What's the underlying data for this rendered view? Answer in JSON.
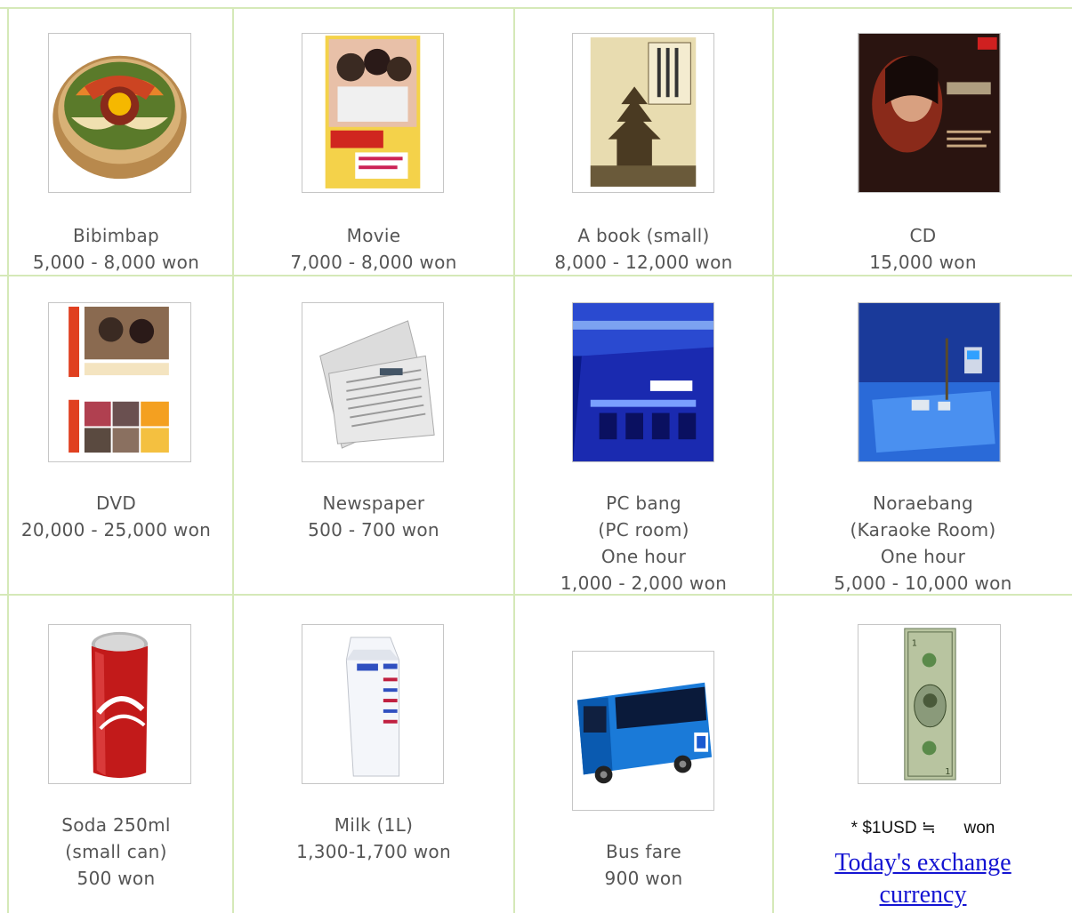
{
  "items": [
    {
      "name": "Bibimbap",
      "lines": [
        "Bibimbap",
        "5,000 - 8,000 won"
      ]
    },
    {
      "name": "Movie",
      "lines": [
        "Movie",
        "7,000 - 8,000 won"
      ]
    },
    {
      "name": "A book (small)",
      "lines": [
        "A book (small)",
        "8,000 - 12,000 won"
      ]
    },
    {
      "name": "CD",
      "lines": [
        "CD",
        "15,000 won"
      ]
    },
    {
      "name": "DVD",
      "lines": [
        "DVD",
        "20,000 - 25,000 won"
      ]
    },
    {
      "name": "Newspaper",
      "lines": [
        "Newspaper",
        "500 - 700 won"
      ]
    },
    {
      "name": "PC bang",
      "lines": [
        "PC bang",
        "(PC room)",
        "One hour",
        "1,000 - 2,000 won"
      ]
    },
    {
      "name": "Noraebang",
      "lines": [
        "Noraebang",
        "(Karaoke Room)",
        "One hour",
        "5,000 - 10,000 won"
      ]
    },
    {
      "name": "Soda",
      "lines": [
        "Soda 250ml",
        "(small can)",
        "500 won"
      ]
    },
    {
      "name": "Milk",
      "lines": [
        "Milk (1L)",
        "1,300-1,700 won"
      ]
    },
    {
      "name": "Bus fare",
      "lines": [
        "Bus fare",
        "900 won"
      ]
    }
  ],
  "exchange": {
    "usd_text": "* $1USD ≒      won",
    "link_line1": "Today's exchange",
    "link_line2": "currency"
  },
  "colors": {
    "grid_line": "#d5e9b8",
    "caption_text": "#555555",
    "link": "#1414d2"
  }
}
